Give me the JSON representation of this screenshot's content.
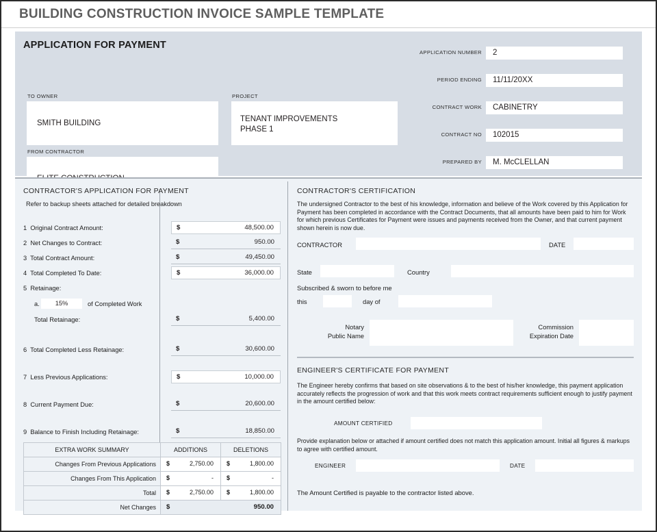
{
  "document": {
    "title": "BUILDING CONSTRUCTION INVOICE SAMPLE TEMPLATE",
    "section_title": "APPLICATION FOR PAYMENT"
  },
  "colors": {
    "top_panel_bg": "#d7dde5",
    "lower_panel_bg": "#eef2f6",
    "title_text": "#5e5e5e",
    "field_bg": "#ffffff",
    "divider": "#9fa6ad"
  },
  "header": {
    "to_owner": {
      "label": "TO OWNER",
      "value": "SMITH BUILDING"
    },
    "from_contractor": {
      "label": "FROM CONTRACTOR",
      "value": "ELITE CONSTRUCTION"
    },
    "project": {
      "label": "PROJECT",
      "value_line1": "TENANT IMPROVEMENTS",
      "value_line2": "PHASE 1"
    },
    "meta": [
      {
        "label": "APPLICATION NUMBER",
        "value": "2"
      },
      {
        "label": "PERIOD ENDING",
        "value": "11/11/20XX"
      },
      {
        "label": "CONTRACT WORK",
        "value": "CABINETRY"
      },
      {
        "label": "CONTRACT NO",
        "value": "102015"
      },
      {
        "label": "PREPARED BY",
        "value": "M. McCLELLAN"
      }
    ]
  },
  "application": {
    "heading": "CONTRACTOR'S APPLICATION FOR PAYMENT",
    "subheading": "Refer to backup sheets attached for detailed breakdown",
    "currency_symbol": "$",
    "lines": [
      {
        "no": "1",
        "label": "Original Contract Amount:",
        "amount": "48,500.00"
      },
      {
        "no": "2",
        "label": "Net Changes to Contract:",
        "amount": "950.00"
      },
      {
        "no": "3",
        "label": "Total Contract Amount:",
        "amount": "49,450.00"
      },
      {
        "no": "4",
        "label": "Total Completed To Date:",
        "amount": "36,000.00"
      },
      {
        "no": "5",
        "label": "Retainage:",
        "amount": ""
      },
      {
        "no": "6",
        "label": "Total Completed Less Retainage:",
        "amount": "30,600.00"
      },
      {
        "no": "7",
        "label": "Less Previous Applications:",
        "amount": "10,000.00"
      },
      {
        "no": "8",
        "label": "Current Payment Due:",
        "amount": "20,600.00"
      },
      {
        "no": "9",
        "label": "Balance to Finish Including Retainage:",
        "amount": "18,850.00"
      }
    ],
    "retainage": {
      "sub_marker": "a.",
      "percent": "15%",
      "of_completed_work": "of Completed Work",
      "total_label": "Total Retainage:",
      "total_amount": "5,400.00"
    }
  },
  "extra_work_summary": {
    "columns": [
      "EXTRA WORK SUMMARY",
      "ADDITIONS",
      "DELETIONS"
    ],
    "rows": [
      {
        "label": "Changes From Previous Applications",
        "additions": "2,750.00",
        "deletions": "1,800.00"
      },
      {
        "label": "Changes From This Application",
        "additions": "-",
        "deletions": "-"
      },
      {
        "label": "Total",
        "additions": "2,750.00",
        "deletions": "1,800.00"
      }
    ],
    "net_changes": {
      "label": "Net Changes",
      "value": "950.00"
    },
    "currency_symbol": "$"
  },
  "certification": {
    "heading": "CONTRACTOR'S CERTIFICATION",
    "paragraph": "The undersigned Contractor to the best of his knowledge, information and believe of the Work covered by this Application for Payment has been completed in accordance with the Contract Documents, that all amounts have been paid to him for Work for which previous Certificates for Payment were issues and payments received from the Owner, and that current payment shown herein is now due.",
    "contractor_label": "CONTRACTOR",
    "date_label": "DATE",
    "state_label": "State",
    "country_label": "Country",
    "sworn_text": "Subscribed & sworn to before me",
    "this_label": "this",
    "day_of_label": "day of",
    "notary_label_line1": "Notary",
    "notary_label_line2": "Public Name",
    "commission_label_line1": "Commission",
    "commission_label_line2": "Expiration Date",
    "contractor_value": "",
    "date_value": "",
    "state_value": "",
    "country_value": "",
    "this_value": "",
    "day_of_value": "",
    "notary_value": "",
    "commission_value": ""
  },
  "engineer": {
    "heading": "ENGINEER'S CERTIFICATE FOR PAYMENT",
    "paragraph": "The Engineer hereby confirms that based on site observations & to the best of his/her knowledge, this payment application accurately reflects the progression of work and that this work meets contract requirements sufficient enough to justify payment in the amount certified below:",
    "amount_certified_label": "AMOUNT CERTIFIED",
    "amount_certified_value": "",
    "explanation": "Provide explanation below or attached if amount certified does not match this application amount. Initial all figures & markups to agree with certified amount.",
    "engineer_label": "ENGINEER",
    "engineer_value": "",
    "date_label": "DATE",
    "date_value": "",
    "footer": "The Amount Certified is payable to the contractor listed above."
  }
}
